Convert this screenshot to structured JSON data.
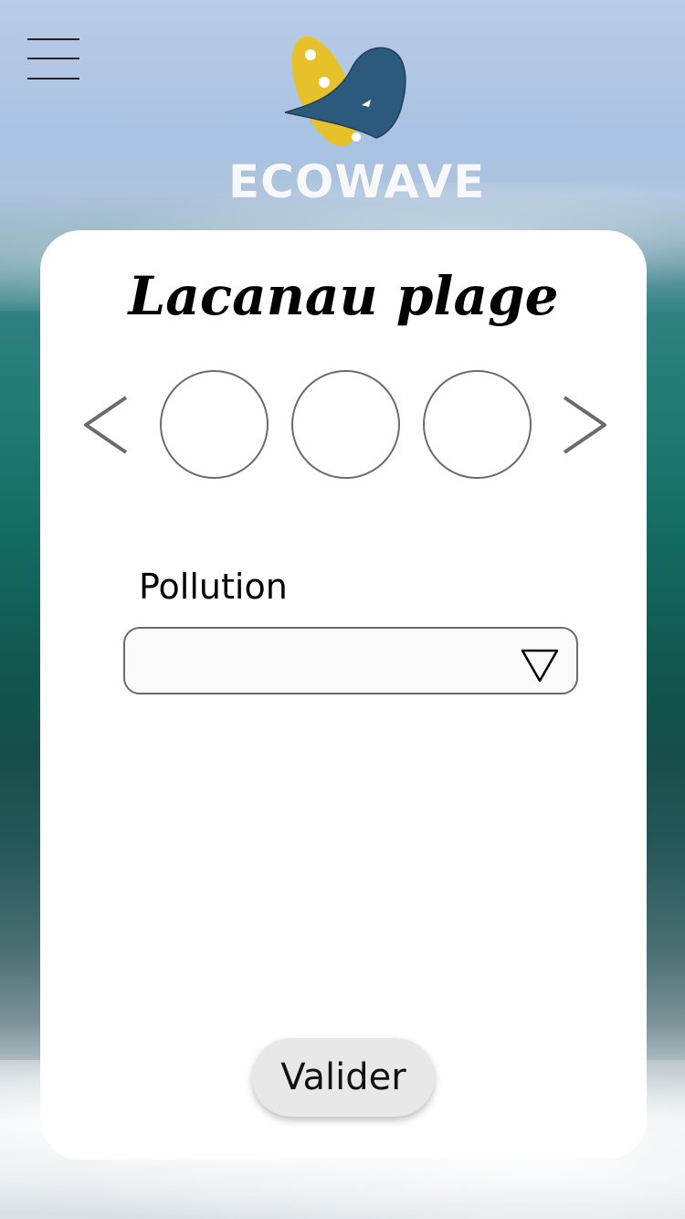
{
  "app": {
    "brand_name": "ECOWAVE"
  },
  "header": {
    "menu_icon": "hamburger-menu-icon",
    "logo_icon": "surfboard-wave-logo-icon"
  },
  "card": {
    "title": "Lacanau plage",
    "carousel": {
      "prev_icon": "chevron-left-icon",
      "next_icon": "chevron-right-icon",
      "items": [
        "",
        "",
        ""
      ]
    },
    "pollution": {
      "label": "Pollution",
      "selected_value": "",
      "caret_icon": "triangle-down-icon"
    },
    "submit_label": "Valider"
  },
  "colors": {
    "logo_yellow": "#e6c129",
    "logo_blue": "#2c5a7d",
    "card_background": "#ffffff",
    "button_background": "#e8e8e8",
    "outline_gray": "#6b6b6b"
  }
}
